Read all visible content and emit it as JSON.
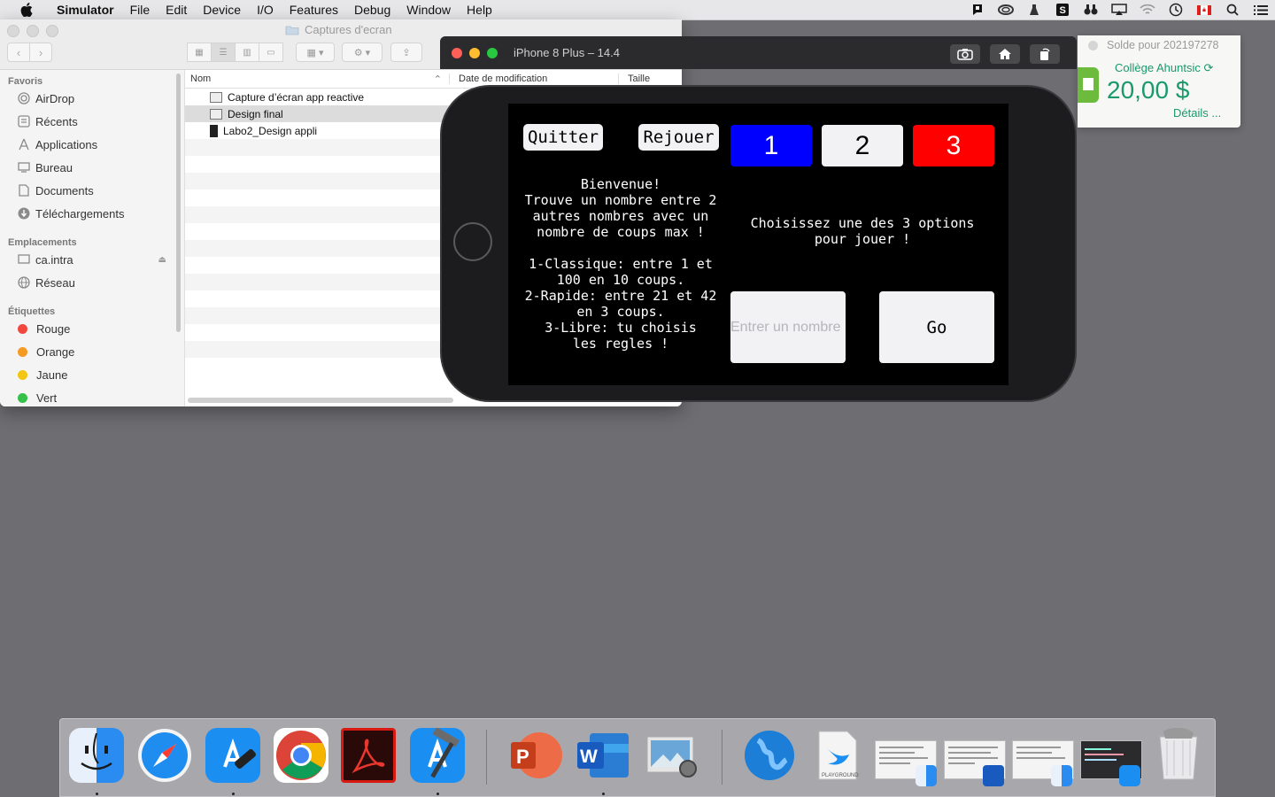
{
  "menubar": {
    "app": "Simulator",
    "items": [
      "File",
      "Edit",
      "Device",
      "I/O",
      "Features",
      "Debug",
      "Window",
      "Help"
    ]
  },
  "finder": {
    "title": "Captures d'ecran",
    "sidebar": {
      "favoris": "Favoris",
      "favorites": [
        "AirDrop",
        "Récents",
        "Applications",
        "Bureau",
        "Documents",
        "Téléchargements"
      ],
      "emplacements": "Emplacements",
      "locations": [
        "ca.intra",
        "Réseau"
      ],
      "etiquettes": "Étiquettes",
      "tags": [
        {
          "label": "Rouge",
          "color": "#f0473f"
        },
        {
          "label": "Orange",
          "color": "#f59a23"
        },
        {
          "label": "Jaune",
          "color": "#f2c611"
        },
        {
          "label": "Vert",
          "color": "#35c049"
        }
      ]
    },
    "columns": {
      "name": "Nom",
      "date": "Date de modification",
      "size": "Taille"
    },
    "files": [
      "Capture d’écran app reactive",
      "Design final",
      "Labo2_Design appli"
    ]
  },
  "simulator": {
    "title": "iPhone 8 Plus – 14.4"
  },
  "app": {
    "quit": "Quitter",
    "replay": "Rejouer",
    "options": [
      {
        "label": "1",
        "bg": "#0000ff",
        "fg": "#ffffff"
      },
      {
        "label": "2",
        "bg": "#f2f2f5",
        "fg": "#000000"
      },
      {
        "label": "3",
        "bg": "#ff0000",
        "fg": "#ffffff"
      }
    ],
    "welcome": "Bienvenue!\nTrouve un nombre entre 2\nautres nombres avec un\nnombre de coups max !\n\n1-Classique: entre 1 et\n100 en 10 coups.\n2-Rapide: entre 21 et 42\nen 3 coups.\n3-Libre: tu choisis\nles regles !",
    "prompt": "Choisissez une des 3 options\npour jouer !",
    "input_placeholder": "Entrer un nombre",
    "go": "Go"
  },
  "notification": {
    "top": "Solde pour 202197278",
    "school": "Collège Ahuntsic",
    "amount": "20,00 $",
    "details": "Détails ..."
  },
  "dock": {
    "word_letter": "W",
    "ppt_letter": "P",
    "playground": "PLAYGROUND"
  }
}
